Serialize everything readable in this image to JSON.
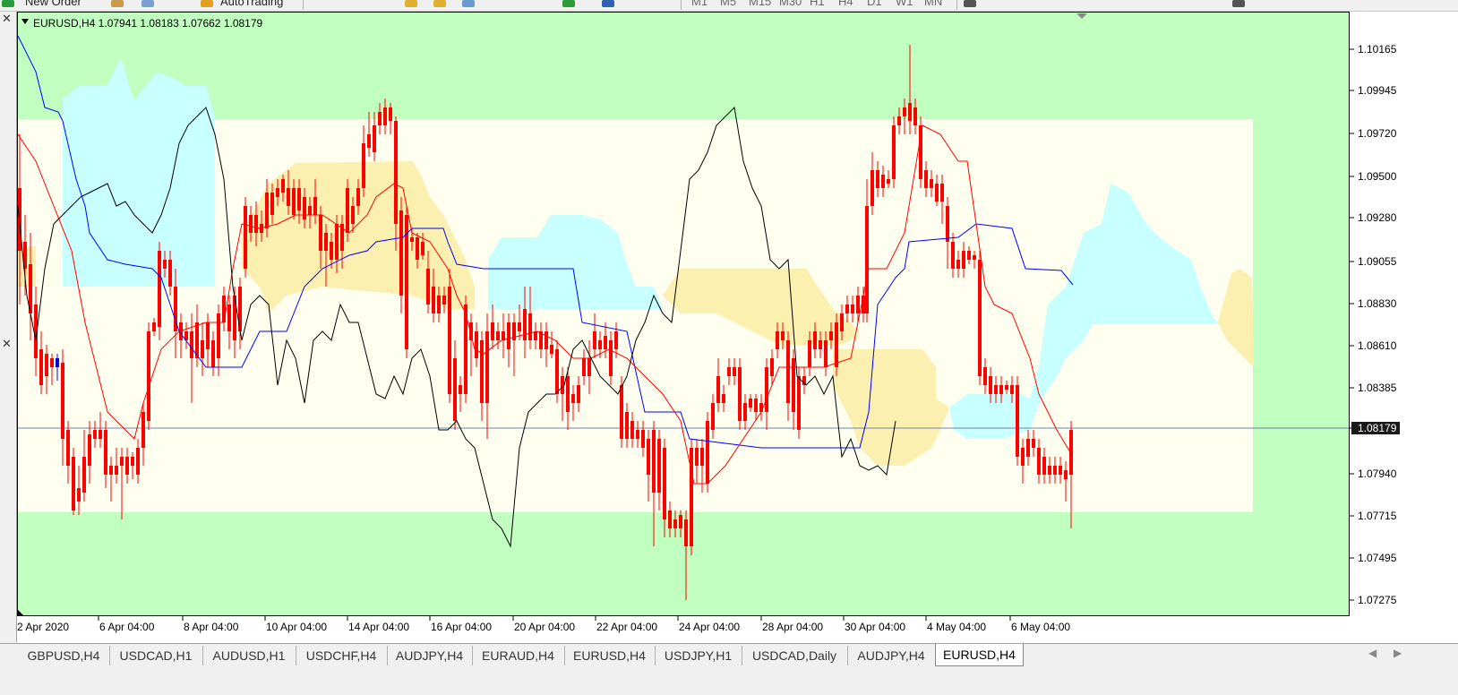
{
  "toolbar": {
    "new_order": "New Order",
    "auto_trading": "AutoTrading",
    "timeframes": [
      "M1",
      "M5",
      "M15",
      "M30",
      "H1",
      "H4",
      "D1",
      "W1",
      "MN"
    ]
  },
  "chart": {
    "header": "EURUSD,H4  1.07941 1.08183 1.07662 1.08179",
    "current_price": "1.08179",
    "price_labels": [
      "1.10165",
      "1.09945",
      "1.09720",
      "1.09500",
      "1.09280",
      "1.09055",
      "1.08830",
      "1.08610",
      "1.08385",
      "1.08179",
      "1.07940",
      "1.07715",
      "1.07495",
      "1.07275"
    ],
    "time_labels": [
      "2 Apr 2020",
      "6 Apr 04:00",
      "8 Apr 04:00",
      "10 Apr 04:00",
      "14 Apr 04:00",
      "16 Apr 04:00",
      "20 Apr 04:00",
      "22 Apr 04:00",
      "24 Apr 04:00",
      "28 Apr 04:00",
      "30 Apr 04:00",
      "4 May 04:00",
      "6 May 04:00"
    ],
    "colors": {
      "outer_zone": "#c0ffc0",
      "inner_zone": "#fffff0",
      "bull_candle": "#0000dd",
      "bear_candle": "#ff0000",
      "kijun": "#0000ff",
      "tenkan": "#ff0000",
      "chikou": "#000000",
      "cloud_bull": "#c8ffff",
      "cloud_bear": "#fcf0b0",
      "price_line": "#7080b0"
    }
  },
  "tabs": [
    {
      "label": "GBPUSD,H4"
    },
    {
      "label": "USDCAD,H1"
    },
    {
      "label": "AUDUSD,H1"
    },
    {
      "label": "USDCHF,H4"
    },
    {
      "label": "AUDJPY,H4"
    },
    {
      "label": "EURAUD,H4"
    },
    {
      "label": "EURUSD,H4"
    },
    {
      "label": "USDJPY,H1"
    },
    {
      "label": "USDCAD,Daily"
    },
    {
      "label": "AUDJPY,H4"
    },
    {
      "label": "EURUSD,H4",
      "active": true
    }
  ]
}
